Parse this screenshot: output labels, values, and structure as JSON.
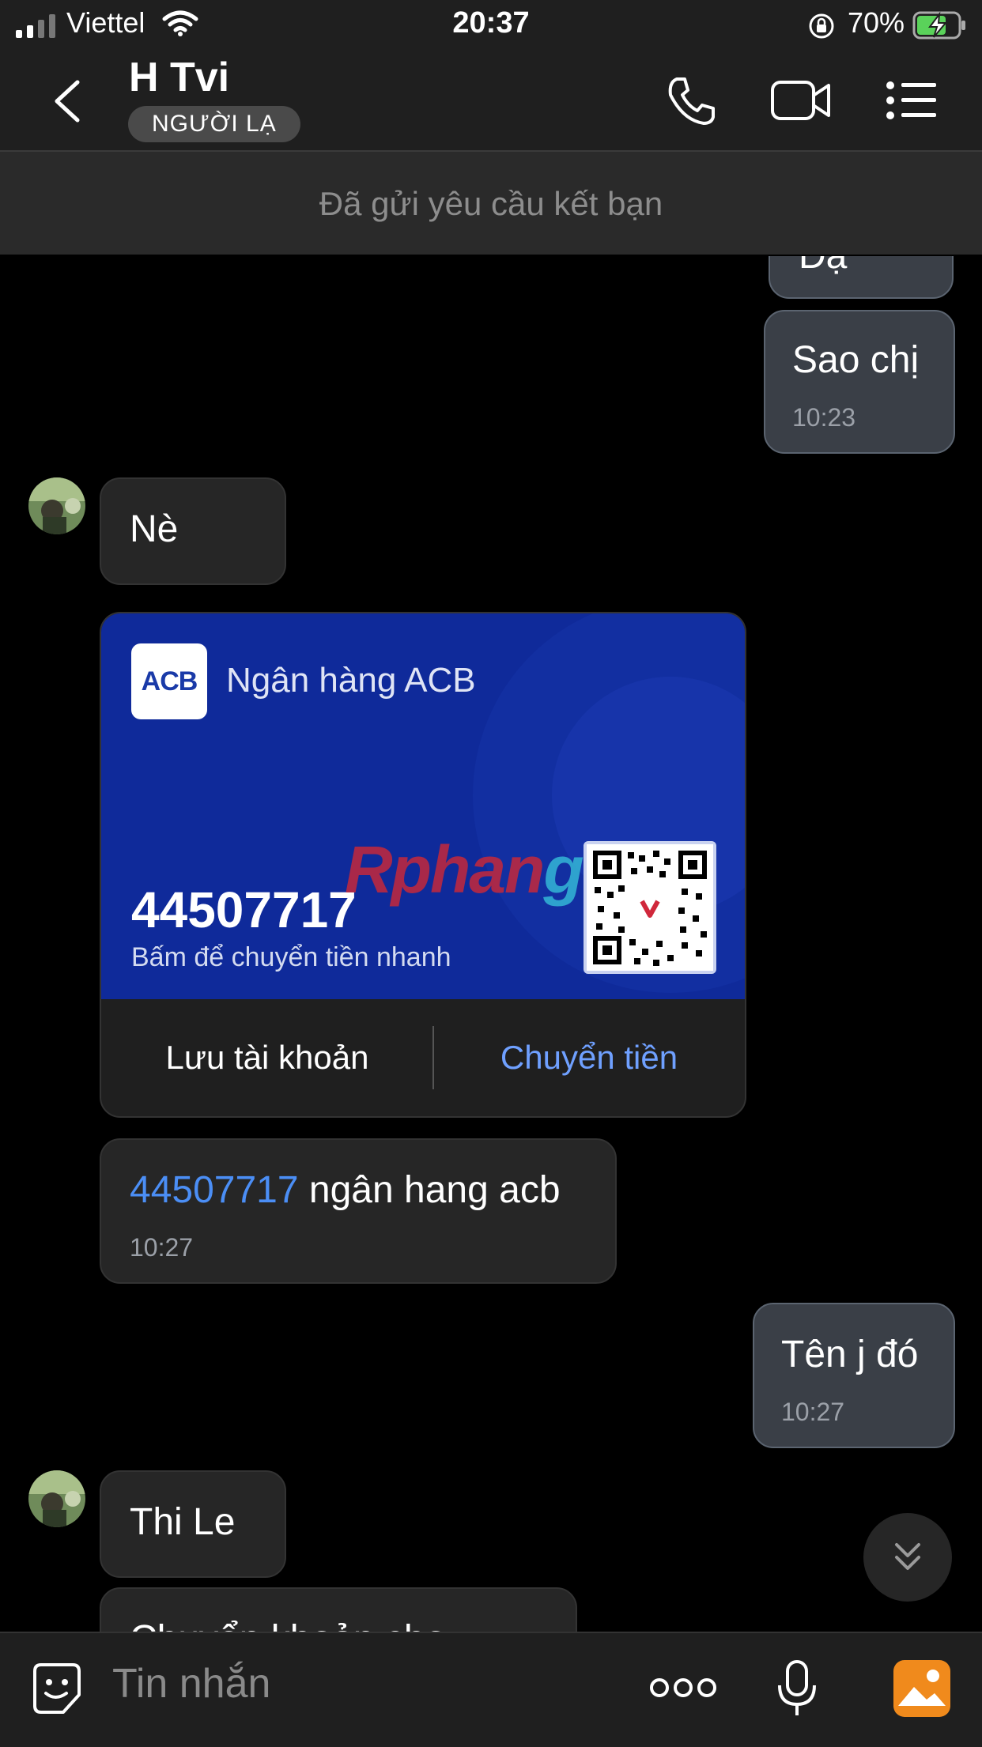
{
  "status_bar": {
    "carrier": "Viettel",
    "time": "20:37",
    "battery": "70%"
  },
  "header": {
    "contact_name": "H Tvi",
    "badge": "NGƯỜI LẠ",
    "icons": [
      "back-icon",
      "phone-icon",
      "video-icon",
      "menu-icon"
    ]
  },
  "friend_request_text": "Đã gửi yêu cầu kết bạn",
  "messages": {
    "m0_partial": "Dạ",
    "m1": {
      "text": "Sao chị",
      "time": "10:23"
    },
    "m2": {
      "text": "Nè"
    },
    "card": {
      "bank_name": "Ngân hàng ACB",
      "logo_text": "ACB",
      "account_number": "44507717",
      "subtitle": "Bấm để chuyển tiền nhanh",
      "save_button": "Lưu tài khoản",
      "transfer_button": "Chuyển tiền"
    },
    "m3": {
      "link": "44507717",
      "text": " ngân hang acb",
      "time": "10:27"
    },
    "m4": {
      "text": "Tên j đó",
      "time": "10:27"
    },
    "m5": {
      "text": "Thi Le"
    },
    "m6_partial": "Chuyển khoản cho"
  },
  "watermark": {
    "part1": "Rphan",
    "part2": "g"
  },
  "input": {
    "placeholder": "Tin nhắn"
  },
  "colors": {
    "accent_blue": "#4b8ef5",
    "card_blue": "#0f2a9a",
    "outgoing_bubble": "#3a3f47",
    "incoming_bubble": "#262626",
    "gallery_orange": "#f08a1c",
    "battery_green": "#5ad25a"
  }
}
